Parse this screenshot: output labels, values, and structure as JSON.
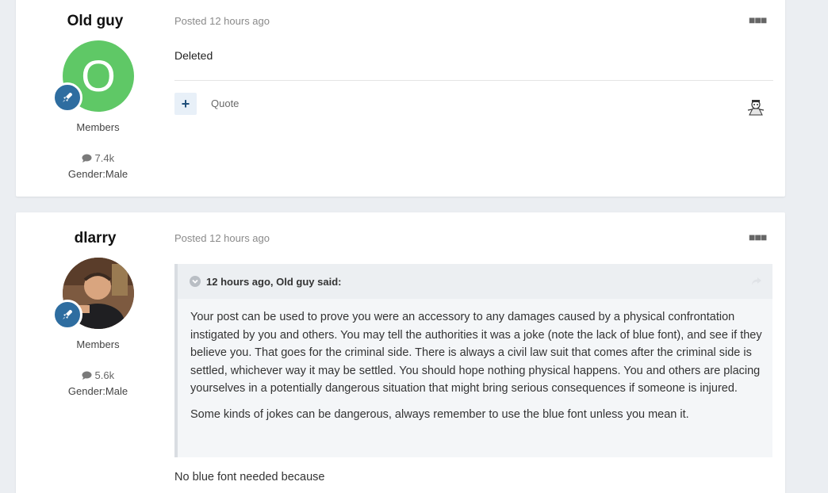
{
  "posts": [
    {
      "author": "Old guy",
      "avatar_letter": "O",
      "avatar_color": "#5fc866",
      "group": "Members",
      "post_count": "7.4k",
      "gender": "Gender:Male",
      "posted_prefix": "Posted",
      "posted_time": "12 hours ago",
      "content": "Deleted",
      "quote_label": "Quote",
      "plus_label": "+"
    },
    {
      "author": "dlarry",
      "group": "Members",
      "post_count": "5.6k",
      "gender": "Gender:Male",
      "posted_prefix": "Posted",
      "posted_time": "12 hours ago",
      "quote": {
        "header": "12 hours ago, Old guy said:",
        "paragraphs": [
          "Your post can be used to prove you were an accessory to any damages caused by a physical confrontation instigated by you and others. You may tell the authorities it was a joke (note the lack of blue font), and see if they believe you. That goes for the criminal side. There is always a civil law suit that comes after the criminal side is settled, whichever way it may be settled. You should hope nothing physical happens. You and others are placing yourselves in a potentially dangerous situation that might bring serious consequences if someone is injured.",
          "Some kinds of jokes can be dangerous, always remember to use the blue font unless you mean it."
        ]
      },
      "content": "No blue font needed because"
    }
  ],
  "icons": {
    "rank": "rocket-icon",
    "comment": "comment-icon",
    "more": "ellipsis-icon",
    "collapse": "chevron-down-icon",
    "share": "share-icon",
    "reaction": "reaction-icon"
  },
  "colors": {
    "rank_badge": "#2e6da0",
    "accent": "#1f4f7a"
  }
}
